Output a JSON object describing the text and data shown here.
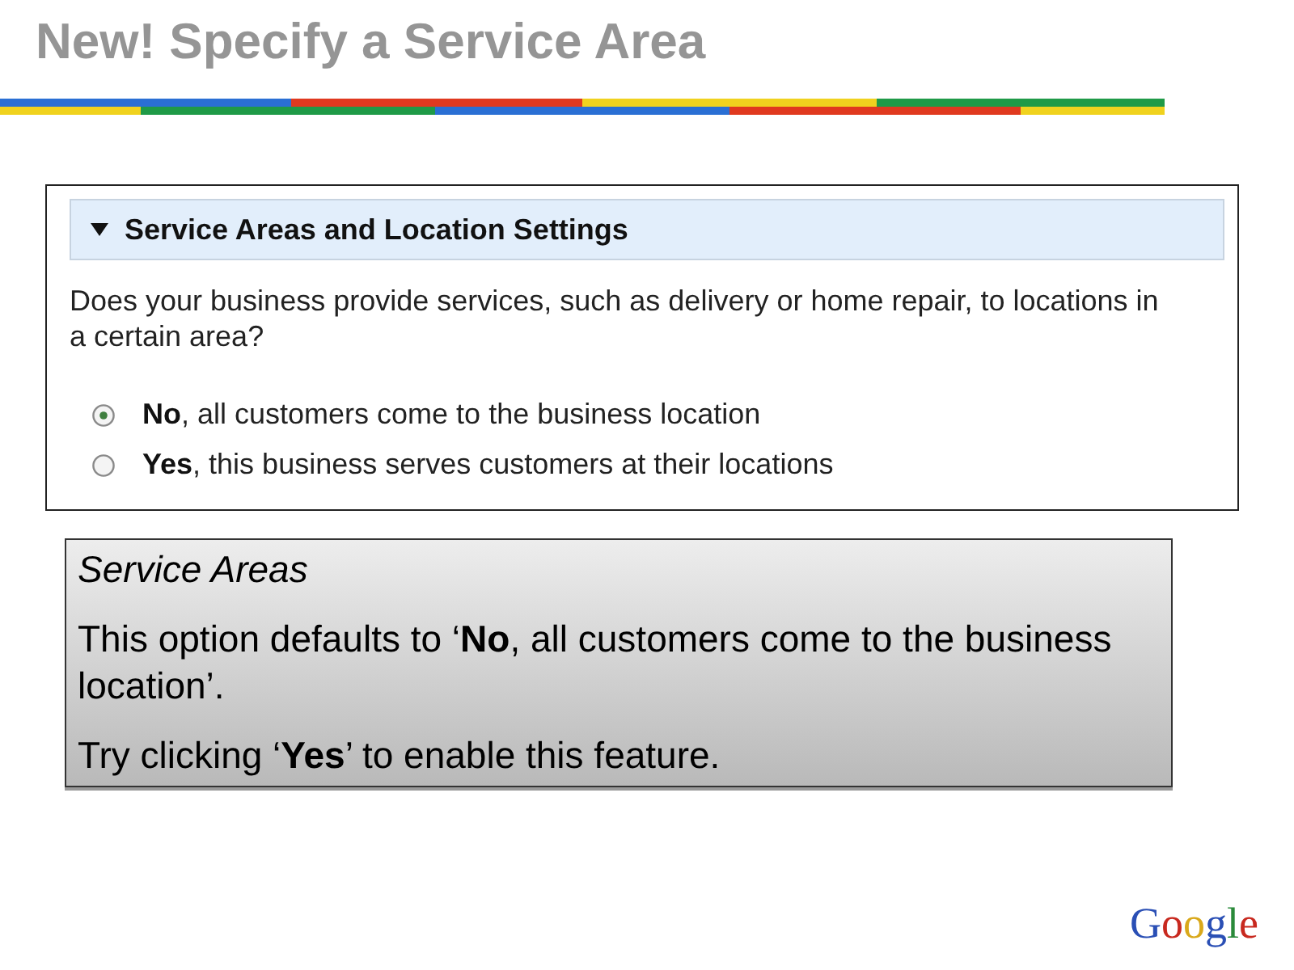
{
  "title": "New! Specify a Service Area",
  "settings_panel": {
    "section": {
      "title": "Service Areas and Location Settings",
      "expanded": true
    },
    "question": "Does your business provide services, such as delivery or home repair, to locations in a certain area?",
    "options": [
      {
        "label": "**No**, all customers come to the business location",
        "selected": true
      },
      {
        "label": "**Yes**, this business serves customers at their locations",
        "selected": false
      }
    ]
  },
  "callout": {
    "title": "Service Areas",
    "paragraphs": [
      "This option defaults to ‘**No**, all customers come to the business location’.",
      "Try clicking ‘**Yes**’ to enable this feature."
    ]
  },
  "logo": "Google"
}
